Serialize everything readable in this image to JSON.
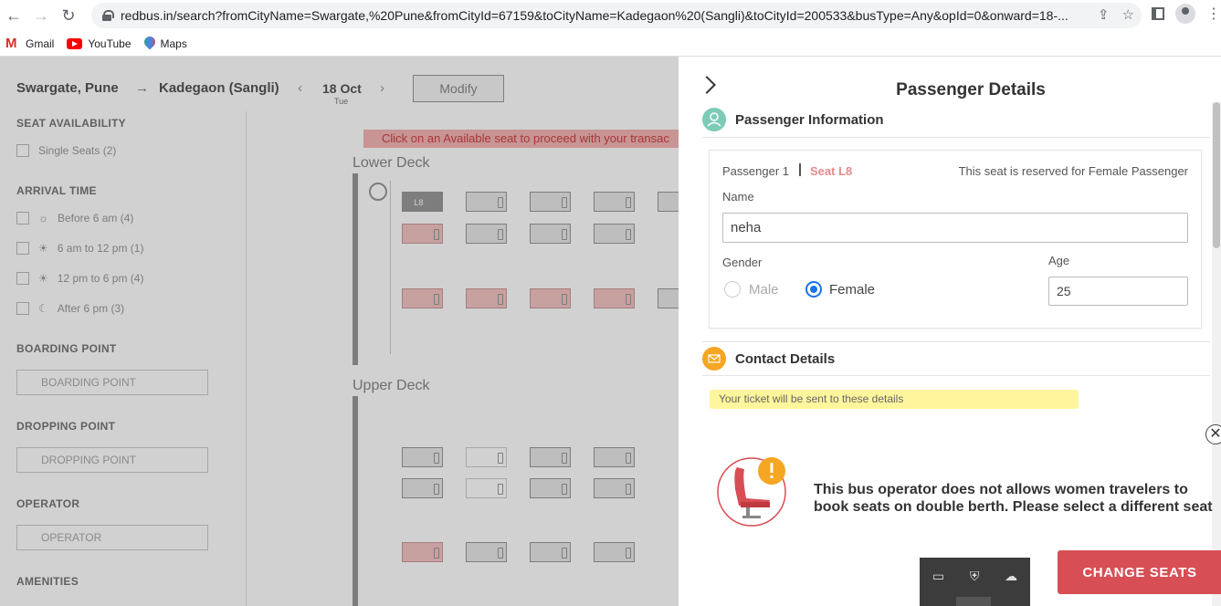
{
  "browser": {
    "url": "redbus.in/search?fromCityName=Swargate,%20Pune&fromCityId=67159&toCityName=Kadegaon%20(Sangli)&toCityId=200533&busType=Any&opId=0&onward=18-...",
    "bookmarks": [
      {
        "label": "Gmail",
        "icon": "gmail-icon"
      },
      {
        "label": "YouTube",
        "icon": "youtube-icon"
      },
      {
        "label": "Maps",
        "icon": "maps-icon"
      }
    ]
  },
  "search": {
    "from": "Swargate, Pune",
    "to": "Kadegaon (Sangli)",
    "date": "18 Oct",
    "day": "Tue",
    "modify_label": "Modify"
  },
  "filters": {
    "seat_availability": "SEAT AVAILABILITY",
    "single_seats": "Single Seats (2)",
    "arrival_time": "ARRIVAL TIME",
    "arrival_options": [
      "Before 6 am (4)",
      "6 am to 12 pm (1)",
      "12 pm to 6 pm (4)",
      "After 6 pm (3)"
    ],
    "boarding_point": "BOARDING POINT",
    "boarding_placeholder": "BOARDING POINT",
    "dropping_point": "DROPPING POINT",
    "dropping_placeholder": "DROPPING POINT",
    "operator": "OPERATOR",
    "operator_placeholder": "OPERATOR",
    "amenities": "AMENITIES"
  },
  "seat_layout": {
    "notice": "Click on an Available seat to proceed with your transac",
    "lower_deck": "Lower Deck",
    "upper_deck": "Upper Deck",
    "selected_seat": "L8"
  },
  "panel": {
    "title": "Passenger Details",
    "passenger_info_title": "Passenger Information",
    "passenger_label": "Passenger 1",
    "seat_label": "Seat L8",
    "reserved_note": "This seat is reserved for Female Passenger",
    "name_label": "Name",
    "name_value": "neha",
    "gender_label": "Gender",
    "male_label": "Male",
    "female_label": "Female",
    "age_label": "Age",
    "age_value": "25",
    "contact_title": "Contact Details",
    "ticket_note": "Your ticket will be sent to these details",
    "warning_text": "This bus operator does not allows women travelers to book seats on double berth. Please select a different seat",
    "change_seats_label": "CHANGE SEATS",
    "close_symbol": "✕",
    "accent": "#d84e55",
    "selected_gender": "Female"
  }
}
